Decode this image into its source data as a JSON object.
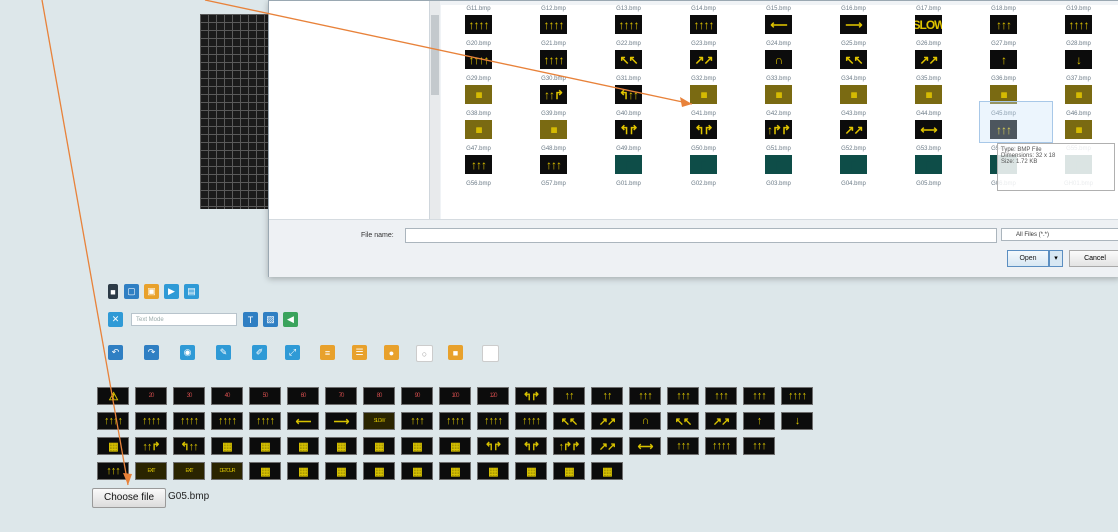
{
  "dialog": {
    "rows": [
      [
        "G11.bmp",
        "G12.bmp",
        "G13.bmp",
        "G14.bmp",
        "G15.bmp",
        "G16.bmp",
        "G17.bmp",
        "G18.bmp",
        "G19.bmp"
      ],
      [
        "G20.bmp",
        "G21.bmp",
        "G22.bmp",
        "G23.bmp",
        "G24.bmp",
        "G25.bmp",
        "G26.bmp",
        "G27.bmp",
        "G28.bmp"
      ],
      [
        "G29.bmp",
        "G30.bmp",
        "G31.bmp",
        "G32.bmp",
        "G33.bmp",
        "G34.bmp",
        "G35.bmp",
        "G36.bmp",
        "G37.bmp"
      ],
      [
        "G38.bmp",
        "G39.bmp",
        "G40.bmp",
        "G41.bmp",
        "G42.bmp",
        "G43.bmp",
        "G44.bmp",
        "G45.bmp",
        "G46.bmp"
      ],
      [
        "G47.bmp",
        "G48.bmp",
        "G49.bmp",
        "G50.bmp",
        "G51.bmp",
        "G52.bmp",
        "G53.bmp",
        "G54.bmp",
        "G55.bmp"
      ],
      [
        "G56.bmp",
        "G57.bmp",
        "G01.bmp",
        "G02.bmp",
        "G03.bmp",
        "G04.bmp",
        "G05.bmp",
        "G06.bmp",
        "GH01.bmp"
      ]
    ],
    "thumbs": [
      [
        "↑↑↑↑",
        "↑↑↑↑",
        "↑↑↑↑",
        "↑↑↑↑",
        "⟵",
        "⟶",
        "SLOW",
        "↑↑↑",
        "↑↑↑↑"
      ],
      [
        "↑↑↑↑",
        "↑↑↑↑",
        "↖↖",
        "↗↗",
        "∩",
        "↖↖",
        "↗↗",
        "↑",
        "↓"
      ],
      [
        "▦",
        "↑↑↱",
        "↰↑↑",
        "▦",
        "▦",
        "▦",
        "▦",
        "▦",
        "▦"
      ],
      [
        "▦",
        "▦",
        "↰↱",
        "↰↱",
        "↑↱↱",
        "↗↗",
        "⟷",
        "↑↑↑",
        "▦"
      ],
      [
        "↑↑↑",
        "↑↑↑",
        "▮",
        "▮",
        "▮",
        "▮",
        "▮",
        "▮",
        "▮"
      ]
    ],
    "file_name_label": "File name:",
    "file_name_value": "",
    "file_type": "All Files (*.*)",
    "open_label": "Open",
    "cancel_label": "Cancel",
    "tooltip_lines": [
      "Type: BMP File",
      "Dimensions: 32 x 18",
      "Size: 1.72 KB"
    ]
  },
  "toolbar1": {
    "colors": [
      "#2d3b47",
      "#2f7fc3",
      "#e8a12c",
      "#2f9ad6",
      "#2f9ad6"
    ]
  },
  "toolbar2": {
    "text_placeholder": "Text Mode"
  },
  "palette": {
    "row1": [
      "⚠",
      "20",
      "30",
      "40",
      "50",
      "60",
      "70",
      "80",
      "90",
      "100",
      "120",
      "↰↱",
      "↑↑",
      "↑↑",
      "↑↑↑",
      "↑↑↑",
      "↑↑↑",
      "↑↑↑",
      "↑↑↑↑"
    ],
    "row2": [
      "↑↑↑↑",
      "↑↑↑↑",
      "↑↑↑↑",
      "↑↑↑↑",
      "↑↑↑↑",
      "⟵",
      "⟶",
      "SLOW",
      "↑↑↑",
      "↑↑↑↑",
      "↑↑↑↑",
      "↑↑↑↑",
      "↖↖",
      "↗↗",
      "∩",
      "↖↖",
      "↗↗",
      "↑",
      "↓"
    ],
    "row3": [
      "▦",
      "↑↑↱",
      "↰↑↑",
      "▦",
      "▦",
      "▦",
      "▦",
      "▦",
      "▦",
      "▦",
      "↰↱",
      "↰↱",
      "↑↱↱",
      "↗↗",
      "⟷",
      "↑↑↑",
      "↑↑↑↑",
      "↑↑↑"
    ],
    "row4": [
      "↑↑↑",
      "EXIT",
      "EXIT",
      "DETOUR",
      "▦",
      "▦",
      "▦",
      "▦",
      "▦",
      "▦",
      "▦",
      "▦",
      "▦",
      "▦"
    ]
  },
  "file_input": {
    "button_label": "Choose file",
    "chosen": "G05.bmp"
  }
}
